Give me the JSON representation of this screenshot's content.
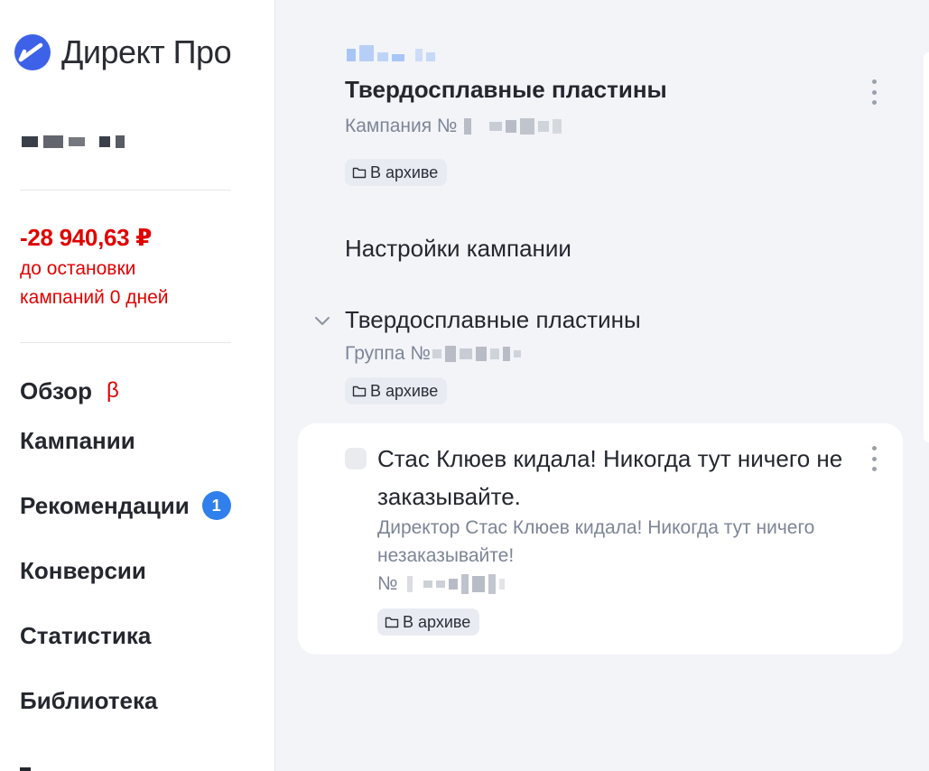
{
  "brand": {
    "name": "Директ Про",
    "accent": "#3d62e8"
  },
  "sidebar": {
    "balance": {
      "amount": "-28 940,63 ₽",
      "note_line1": "до остановки",
      "note_line2": "кампаний 0 дней",
      "color": "#e00000"
    },
    "nav": [
      {
        "label": "Обзор",
        "tag": "β"
      },
      {
        "label": "Кампании"
      },
      {
        "label": "Рекомендации",
        "count": "1"
      },
      {
        "label": "Конверсии"
      },
      {
        "label": "Статистика"
      },
      {
        "label": "Библиотека"
      }
    ]
  },
  "campaign": {
    "title": "Твердосплавные пластины",
    "number_label": "Кампания №",
    "status": "В архиве",
    "menu_icon": "kebab-vertical-icon"
  },
  "settings_link": "Настройки кампании",
  "group": {
    "title": "Твердосплавные пластины",
    "number_label": "Группа №",
    "status": "В архиве",
    "toggle_icon": "chevron-down-icon"
  },
  "ad": {
    "title": "Стас Клюев кидала! Никогда тут ничего не заказывайте.",
    "text": "Директор Стас Клюев кидала! Никогда тут ничего незаказывайте!",
    "number_label": "№",
    "status": "В архиве",
    "menu_icon": "kebab-vertical-icon"
  }
}
